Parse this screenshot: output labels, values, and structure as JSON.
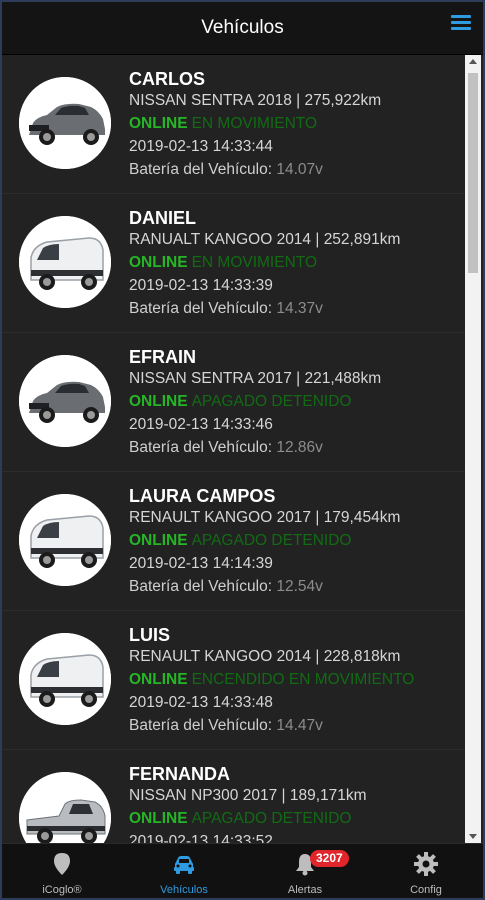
{
  "header": {
    "title": "Vehículos",
    "menu_icon": "hamburger-menu-icon"
  },
  "vehicles": [
    {
      "name": "CARLOS",
      "model": "NISSAN SENTRA 2018 | 275,922km",
      "online": "ONLINE",
      "state": "EN MOVIMIENTO",
      "time": "2019-02-13 14:33:44",
      "battery_label": "Batería del Vehículo: ",
      "battery": "14.07v",
      "image": "sedan"
    },
    {
      "name": "DANIEL",
      "model": "RANUALT KANGOO 2014 | 252,891km",
      "online": "ONLINE",
      "state": "EN MOVIMIENTO",
      "time": "2019-02-13 14:33:39",
      "battery_label": "Batería del Vehículo: ",
      "battery": "14.37v",
      "image": "van"
    },
    {
      "name": "EFRAIN",
      "model": "NISSAN SENTRA 2017 | 221,488km",
      "online": "ONLINE",
      "state": "APAGADO DETENIDO",
      "time": "2019-02-13 14:33:46",
      "battery_label": "Batería del Vehículo: ",
      "battery": "12.86v",
      "image": "sedan"
    },
    {
      "name": "LAURA CAMPOS",
      "model": "RENAULT KANGOO 2017 | 179,454km",
      "online": "ONLINE",
      "state": "APAGADO DETENIDO",
      "time": "2019-02-13 14:14:39",
      "battery_label": "Batería del Vehículo: ",
      "battery": "12.54v",
      "image": "van"
    },
    {
      "name": "LUIS",
      "model": "RENAULT KANGOO 2014 | 228,818km",
      "online": "ONLINE",
      "state": "ENCENDIDO EN MOVIMIENTO",
      "time": "2019-02-13 14:33:48",
      "battery_label": "Batería del Vehículo: ",
      "battery": "14.47v",
      "image": "van"
    },
    {
      "name": "FERNANDA",
      "model": "NISSAN NP300 2017 | 189,171km",
      "online": "ONLINE",
      "state": "APAGADO DETENIDO",
      "time": "2019-02-13 14:33:52",
      "battery_label": "",
      "battery": "",
      "image": "pickup"
    }
  ],
  "tabs": [
    {
      "label": "iCoglo®",
      "icon": "map-pin-icon",
      "active": false
    },
    {
      "label": "Vehículos",
      "icon": "car-icon",
      "active": true
    },
    {
      "label": "Alertas",
      "icon": "bell-icon",
      "active": false,
      "badge": "3207"
    },
    {
      "label": "Config",
      "icon": "gear-icon",
      "active": false
    }
  ],
  "colors": {
    "accent": "#2f9be0",
    "online": "#26b527",
    "state": "#126b14",
    "badge": "#e0262a"
  }
}
